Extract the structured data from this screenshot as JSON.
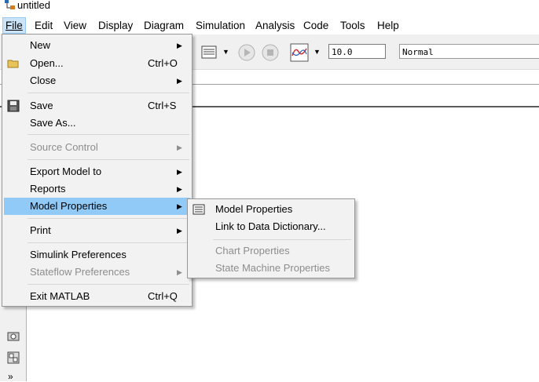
{
  "window": {
    "title": "untitled"
  },
  "menubar": [
    {
      "label": "File",
      "active": true
    },
    {
      "label": "Edit"
    },
    {
      "label": "View"
    },
    {
      "label": "Display"
    },
    {
      "label": "Diagram"
    },
    {
      "label": "Simulation"
    },
    {
      "label": "Analysis"
    },
    {
      "label": "Code"
    },
    {
      "label": "Tools"
    },
    {
      "label": "Help"
    }
  ],
  "toolbar": {
    "stop_time": "10.0",
    "sim_mode": "Normal"
  },
  "file_menu": {
    "items": {
      "new": {
        "label": "New",
        "shortcut": ""
      },
      "open": {
        "label": "Open...",
        "shortcut": "Ctrl+O"
      },
      "close": {
        "label": "Close",
        "shortcut": ""
      },
      "save": {
        "label": "Save",
        "shortcut": "Ctrl+S"
      },
      "save_as": {
        "label": "Save As...",
        "shortcut": ""
      },
      "source_control": {
        "label": "Source Control",
        "enabled": false
      },
      "export_model": {
        "label": "Export Model to"
      },
      "reports": {
        "label": "Reports"
      },
      "model_properties": {
        "label": "Model Properties",
        "highlighted": true
      },
      "print": {
        "label": "Print"
      },
      "simulink_prefs": {
        "label": "Simulink Preferences"
      },
      "stateflow_prefs": {
        "label": "Stateflow Preferences",
        "enabled": false
      },
      "exit": {
        "label": "Exit MATLAB",
        "shortcut": "Ctrl+Q"
      }
    }
  },
  "submenu": {
    "model_properties": {
      "label": "Model Properties"
    },
    "link_dictionary": {
      "label": "Link to Data Dictionary..."
    },
    "chart_properties": {
      "label": "Chart Properties",
      "enabled": false
    },
    "state_machine_properties": {
      "label": "State Machine Properties",
      "enabled": false
    }
  },
  "colors": {
    "highlight": "#91c9f7",
    "menu_bg": "#f2f2f2",
    "disabled_text": "#8d8d8d"
  }
}
